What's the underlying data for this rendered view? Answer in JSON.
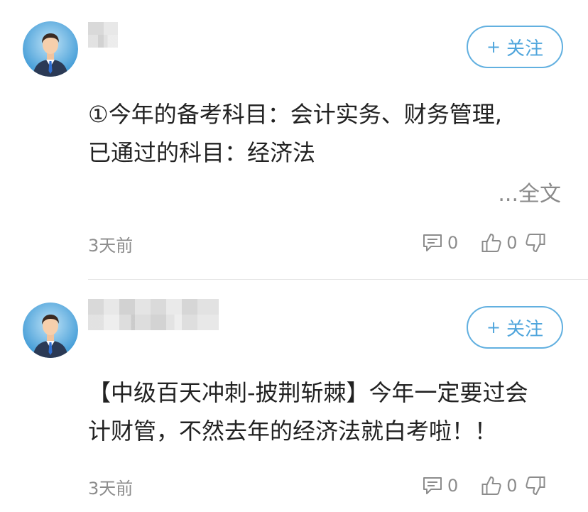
{
  "feed": {
    "posts": [
      {
        "avatar_icon": "user-avatar-icon",
        "follow_label": "关注",
        "content_lines": [
          "①今年的备考科目：会计实务、财务管理,",
          "已通过的科目：经济法"
        ],
        "fulltext_label": "...全文",
        "timestamp": "3天前",
        "comment_count": "0",
        "like_count": "0"
      },
      {
        "avatar_icon": "user-avatar-icon",
        "follow_label": "关注",
        "content_lines": [
          "【中级百天冲刺-披荆斩棘】今年一定要过会",
          "计财管，不然去年的经济法就白考啦！！"
        ],
        "timestamp": "3天前",
        "comment_count": "0",
        "like_count": "0"
      }
    ]
  },
  "icons": {
    "follow_plus": "+",
    "comment": "comment-icon",
    "like": "thumbs-up-icon",
    "dislike": "thumbs-down-icon"
  },
  "colors": {
    "accent": "#4fa5dc",
    "muted_text": "#8c8c8c",
    "body_text": "#222222"
  }
}
